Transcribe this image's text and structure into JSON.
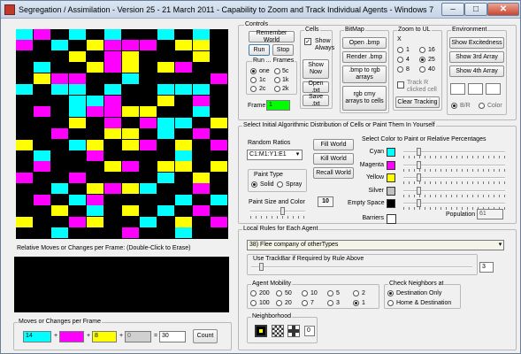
{
  "window": {
    "title": "Segregation / Assimilation - Version 25 - 21 March 2011 - Capability to Zoom and Track Individual Agents - Windows 7",
    "min": "–",
    "max": "□",
    "close": "✕"
  },
  "colors": {
    "cyan": "#00ffff",
    "magenta": "#ff00ff",
    "yellow": "#ffff00",
    "silver": "#c0c0c0",
    "empty": "#000000",
    "barriers": "#ffffff",
    "frame_value": "#00ff00"
  },
  "grid_cells": [
    {
      "c": "cyan",
      "x": 0,
      "y": 0
    },
    {
      "c": "magenta",
      "x": 1,
      "y": 0
    },
    {
      "c": "cyan",
      "x": 3,
      "y": 0
    },
    {
      "c": "cyan",
      "x": 5,
      "y": 0
    },
    {
      "c": "cyan",
      "x": 8,
      "y": 0
    },
    {
      "c": "cyan",
      "x": 10,
      "y": 0
    },
    {
      "c": "magenta",
      "x": 0,
      "y": 1
    },
    {
      "c": "cyan",
      "x": 2,
      "y": 1
    },
    {
      "c": "yellow",
      "x": 4,
      "y": 1
    },
    {
      "c": "magenta",
      "x": 5,
      "y": 1
    },
    {
      "c": "magenta",
      "x": 6,
      "y": 1
    },
    {
      "c": "magenta",
      "x": 7,
      "y": 1
    },
    {
      "c": "yellow",
      "x": 9,
      "y": 1
    },
    {
      "c": "yellow",
      "x": 10,
      "y": 1
    },
    {
      "c": "yellow",
      "x": 3,
      "y": 2
    },
    {
      "c": "magenta",
      "x": 5,
      "y": 2
    },
    {
      "c": "yellow",
      "x": 6,
      "y": 2
    },
    {
      "c": "yellow",
      "x": 10,
      "y": 2
    },
    {
      "c": "cyan",
      "x": 1,
      "y": 3
    },
    {
      "c": "yellow",
      "x": 4,
      "y": 3
    },
    {
      "c": "magenta",
      "x": 5,
      "y": 3
    },
    {
      "c": "yellow",
      "x": 6,
      "y": 3
    },
    {
      "c": "yellow",
      "x": 8,
      "y": 3
    },
    {
      "c": "magenta",
      "x": 9,
      "y": 3
    },
    {
      "c": "yellow",
      "x": 1,
      "y": 4
    },
    {
      "c": "magenta",
      "x": 2,
      "y": 4
    },
    {
      "c": "magenta",
      "x": 3,
      "y": 4
    },
    {
      "c": "cyan",
      "x": 6,
      "y": 4
    },
    {
      "c": "magenta",
      "x": 11,
      "y": 4
    },
    {
      "c": "cyan",
      "x": 0,
      "y": 5
    },
    {
      "c": "cyan",
      "x": 2,
      "y": 5
    },
    {
      "c": "cyan",
      "x": 3,
      "y": 5
    },
    {
      "c": "cyan",
      "x": 5,
      "y": 5
    },
    {
      "c": "cyan",
      "x": 8,
      "y": 5
    },
    {
      "c": "cyan",
      "x": 9,
      "y": 5
    },
    {
      "c": "cyan",
      "x": 10,
      "y": 5
    },
    {
      "c": "cyan",
      "x": 3,
      "y": 6
    },
    {
      "c": "cyan",
      "x": 4,
      "y": 6
    },
    {
      "c": "magenta",
      "x": 5,
      "y": 6
    },
    {
      "c": "yellow",
      "x": 8,
      "y": 6
    },
    {
      "c": "magenta",
      "x": 10,
      "y": 6
    },
    {
      "c": "magenta",
      "x": 1,
      "y": 7
    },
    {
      "c": "cyan",
      "x": 3,
      "y": 7
    },
    {
      "c": "magenta",
      "x": 4,
      "y": 7
    },
    {
      "c": "magenta",
      "x": 5,
      "y": 7
    },
    {
      "c": "yellow",
      "x": 6,
      "y": 7
    },
    {
      "c": "yellow",
      "x": 7,
      "y": 7
    },
    {
      "c": "cyan",
      "x": 10,
      "y": 7
    },
    {
      "c": "yellow",
      "x": 3,
      "y": 8
    },
    {
      "c": "magenta",
      "x": 5,
      "y": 8
    },
    {
      "c": "magenta",
      "x": 7,
      "y": 8
    },
    {
      "c": "cyan",
      "x": 8,
      "y": 8
    },
    {
      "c": "cyan",
      "x": 9,
      "y": 8
    },
    {
      "c": "yellow",
      "x": 11,
      "y": 8
    },
    {
      "c": "magenta",
      "x": 2,
      "y": 9
    },
    {
      "c": "yellow",
      "x": 5,
      "y": 9
    },
    {
      "c": "yellow",
      "x": 6,
      "y": 9
    },
    {
      "c": "cyan",
      "x": 8,
      "y": 9
    },
    {
      "c": "magenta",
      "x": 10,
      "y": 9
    },
    {
      "c": "yellow",
      "x": 0,
      "y": 10
    },
    {
      "c": "cyan",
      "x": 3,
      "y": 10
    },
    {
      "c": "yellow",
      "x": 4,
      "y": 10
    },
    {
      "c": "yellow",
      "x": 6,
      "y": 10
    },
    {
      "c": "magenta",
      "x": 7,
      "y": 10
    },
    {
      "c": "yellow",
      "x": 9,
      "y": 10
    },
    {
      "c": "magenta",
      "x": 11,
      "y": 10
    },
    {
      "c": "cyan",
      "x": 1,
      "y": 11
    },
    {
      "c": "magenta",
      "x": 4,
      "y": 11
    },
    {
      "c": "cyan",
      "x": 9,
      "y": 11
    },
    {
      "c": "magenta",
      "x": 1,
      "y": 12
    },
    {
      "c": "yellow",
      "x": 5,
      "y": 12
    },
    {
      "c": "magenta",
      "x": 6,
      "y": 12
    },
    {
      "c": "yellow",
      "x": 8,
      "y": 12
    },
    {
      "c": "yellow",
      "x": 9,
      "y": 12
    },
    {
      "c": "yellow",
      "x": 11,
      "y": 12
    },
    {
      "c": "magenta",
      "x": 0,
      "y": 13
    },
    {
      "c": "magenta",
      "x": 3,
      "y": 13
    },
    {
      "c": "cyan",
      "x": 8,
      "y": 13
    },
    {
      "c": "yellow",
      "x": 10,
      "y": 13
    },
    {
      "c": "cyan",
      "x": 2,
      "y": 14
    },
    {
      "c": "yellow",
      "x": 4,
      "y": 14
    },
    {
      "c": "magenta",
      "x": 5,
      "y": 14
    },
    {
      "c": "yellow",
      "x": 6,
      "y": 14
    },
    {
      "c": "cyan",
      "x": 7,
      "y": 14
    },
    {
      "c": "magenta",
      "x": 10,
      "y": 14
    },
    {
      "c": "magenta",
      "x": 1,
      "y": 15
    },
    {
      "c": "cyan",
      "x": 3,
      "y": 15
    },
    {
      "c": "magenta",
      "x": 4,
      "y": 15
    },
    {
      "c": "cyan",
      "x": 9,
      "y": 15
    },
    {
      "c": "cyan",
      "x": 11,
      "y": 15
    },
    {
      "c": "yellow",
      "x": 2,
      "y": 16
    },
    {
      "c": "cyan",
      "x": 4,
      "y": 16
    },
    {
      "c": "yellow",
      "x": 6,
      "y": 16
    },
    {
      "c": "cyan",
      "x": 8,
      "y": 16
    },
    {
      "c": "magenta",
      "x": 10,
      "y": 16
    },
    {
      "c": "yellow",
      "x": 0,
      "y": 17
    },
    {
      "c": "magenta",
      "x": 3,
      "y": 17
    },
    {
      "c": "yellow",
      "x": 4,
      "y": 17
    },
    {
      "c": "cyan",
      "x": 7,
      "y": 17
    },
    {
      "c": "yellow",
      "x": 9,
      "y": 17
    },
    {
      "c": "magenta",
      "x": 11,
      "y": 17
    },
    {
      "c": "cyan",
      "x": 2,
      "y": 18
    },
    {
      "c": "magenta",
      "x": 6,
      "y": 18
    },
    {
      "c": "cyan",
      "x": 9,
      "y": 18
    }
  ],
  "moves": {
    "label": "Relative Moves or Changes per Frame:  (Double-Click to Erase)",
    "frame_title": "Moves or Changes per Frame",
    "cyan": "14",
    "magenta": "8",
    "yellow": "8",
    "silver": "0",
    "total": "30",
    "plus": "+",
    "equals": "=",
    "count_button": "Count"
  },
  "controls": {
    "title": "Controls",
    "remember_world": "Remember World",
    "run": "Run",
    "stop": "Stop",
    "run_frames_title": "Run ... Frames",
    "opt_one": "one",
    "opt_5c": "5c",
    "opt_1c": "1c",
    "opt_1k": "1k",
    "opt_2c": "2c",
    "opt_2k": "2k",
    "frame_label": "Frame",
    "frame_value": "1",
    "cells_title": "Cells",
    "show_always": "Show Always",
    "show": "Show Now",
    "open_txt": "Open .txt",
    "save_txt": "Save .txt",
    "bitmap_title": "BitMap",
    "open_bmp": "Open .bmp",
    "render_bmp": "Render .bmp",
    "bmp_to_rgb": ".bmp to rgb arrays",
    "rgb_cmy": "rgb cmy arrays to cells",
    "zoom_title": "Zoom to UL",
    "zoom_x": "X",
    "z1": "1",
    "z4": "4",
    "z8": "8",
    "z16": "16",
    "z25": "25",
    "z40": "40",
    "track": "Track R clicked cell",
    "clear_tracking": "Clear Tracking",
    "env_title": "Environment",
    "show_excitedness": "Show Excitedness",
    "show_3rd": "Show 3rd Array",
    "show_4th": "Show 4th Array",
    "bw": "B/R",
    "color": "Color"
  },
  "distribution": {
    "title": "Select Initial Algorithmic Distribution of Cells or Paint Them In Yourself",
    "random_ratios": "Random Ratios",
    "ratio_value": "C1:M1:Y1:E1",
    "fill_world": "Fill World",
    "kill_world": "Kill World",
    "recall_world": "Recall World",
    "paint_type": "Paint Type",
    "solid": "Solid",
    "spray": "Spray",
    "paint_size": "Paint Size and Color",
    "paint_size_value": "10",
    "select_color": "Select Color to Paint or Relative Percentages",
    "cyan": "Cyan",
    "magenta": "Magenta",
    "yellow": "Yellow",
    "silver": "Silver",
    "empty": "Empty Space",
    "barriers": "Barriers",
    "population": "Population",
    "population_value": "61"
  },
  "rules": {
    "title": "Local Rules for Each Agent",
    "rule_value": "38) Flee company of otherTypes",
    "trackbar_label": "Use TrackBar if Required by Rule Above",
    "trackbar_value": "3",
    "mobility_title": "Agent Mobility",
    "m200": "200",
    "m50": "50",
    "m10": "10",
    "m5": "5",
    "m2": "2",
    "m100": "100",
    "m20": "20",
    "m7": "7",
    "m3": "3",
    "m1": "1",
    "neighbors_title": "Check Neighbors at",
    "dest_only": "Destination Only",
    "home_dest": "Home & Destination",
    "neighborhood_title": "Neighborhood",
    "neighborhood_value": "0"
  }
}
